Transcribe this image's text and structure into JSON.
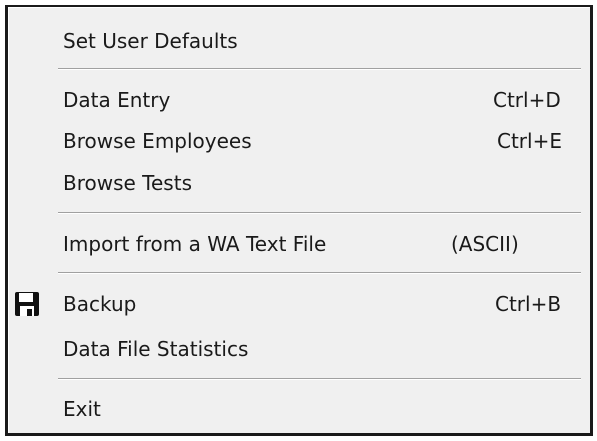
{
  "menu": {
    "items": [
      {
        "label": "Set User Defaults",
        "shortcut": ""
      },
      {
        "label": "Data Entry",
        "shortcut": "Ctrl+D"
      },
      {
        "label": "Browse Employees",
        "shortcut": "Ctrl+E"
      },
      {
        "label": "Browse Tests",
        "shortcut": ""
      },
      {
        "label": "Import from a WA Text File",
        "shortcut": "(ASCII)"
      },
      {
        "label": "Backup",
        "shortcut": "Ctrl+B",
        "icon": "floppy-disk-icon"
      },
      {
        "label": "Data File Statistics",
        "shortcut": ""
      },
      {
        "label": "Exit",
        "shortcut": ""
      }
    ]
  },
  "colors": {
    "background": "#f0f0f0",
    "border": "#1a1a1a",
    "text": "#1a1a1a",
    "separator": "#a0a0a0"
  }
}
